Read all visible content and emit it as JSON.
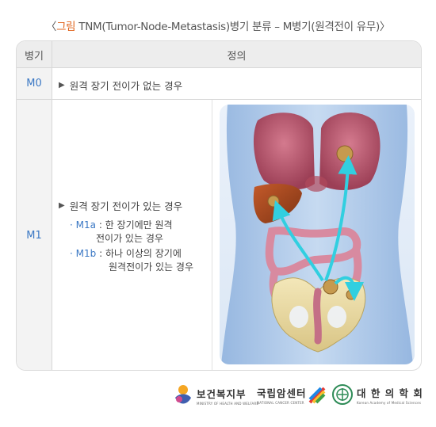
{
  "title": {
    "prefix": "〈",
    "accent": "그림",
    "text": " TNM(Tumor-Node-Metastasis)병기 분류 – M병기(원격전이 유무)〉"
  },
  "table": {
    "header_stage": "병기",
    "header_definition": "정의",
    "rows": [
      {
        "stage": "M0",
        "definition": "원격 장기 전이가 없는 경우"
      },
      {
        "stage": "M1",
        "definition": "원격 장기 전이가 있는 경우",
        "subs": [
          {
            "bullet": "·",
            "code": "M1a",
            "colon": " : ",
            "line1": "한 장기에만 원격",
            "line2": "전이가 있는 경우"
          },
          {
            "bullet": "·",
            "code": "M1b",
            "colon": " : ",
            "line1": "하나 이상의 장기에",
            "line2": "원격전이가 있는 경우"
          }
        ]
      }
    ]
  },
  "logos": {
    "mohw": {
      "name": "보건복지부",
      "sub": "MINISTRY OF HEALTH AND WELFARE"
    },
    "ncc": {
      "name": "국립암센터",
      "sub": "NATIONAL CANCER CENTER"
    },
    "kams": {
      "name": "대 한 의 학 회",
      "sub": "Korean Academy of Medical Sciences"
    }
  },
  "colors": {
    "accent": "#e0651e",
    "stage_blue": "#3b78c4",
    "arrow": "#31cfe0",
    "body": "#a6c4e8"
  }
}
